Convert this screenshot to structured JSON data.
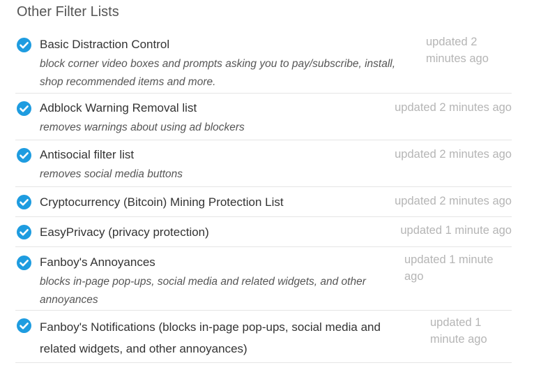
{
  "section": {
    "title": "Other Filter Lists"
  },
  "filters": [
    {
      "icon": "check-circle-icon",
      "name": "Basic Distraction Control",
      "description": "block corner video boxes and prompts asking you to pay/subscribe, install, shop recommended items and more.",
      "updated": "updated 2 minutes ago"
    },
    {
      "icon": "check-circle-icon",
      "name": "Adblock Warning Removal list",
      "description": "removes warnings about using ad blockers",
      "updated": "updated 2 minutes ago"
    },
    {
      "icon": "check-circle-icon",
      "name": "Antisocial filter list",
      "description": "removes social media buttons",
      "updated": "updated 2 minutes ago"
    },
    {
      "icon": "check-circle-icon",
      "name": "Cryptocurrency (Bitcoin) Mining Protection List",
      "description": "",
      "updated": "updated 2 minutes ago"
    },
    {
      "icon": "check-circle-icon",
      "name": "EasyPrivacy (privacy protection)",
      "description": "",
      "updated": "updated 1 minute ago"
    },
    {
      "icon": "check-circle-icon",
      "name": "Fanboy's Annoyances",
      "description": "blocks in-page pop-ups, social media and related widgets, and other annoyances",
      "updated": "updated 1 minute ago"
    },
    {
      "icon": "check-circle-icon",
      "name": "Fanboy's Notifications (blocks in-page pop-ups, social media and related widgets, and other annoyances)",
      "description": "",
      "updated": "updated 1 minute ago"
    }
  ],
  "colors": {
    "accent": "#1e9ce0",
    "muted": "#b5b5b5",
    "divider": "#e5e5e5"
  }
}
